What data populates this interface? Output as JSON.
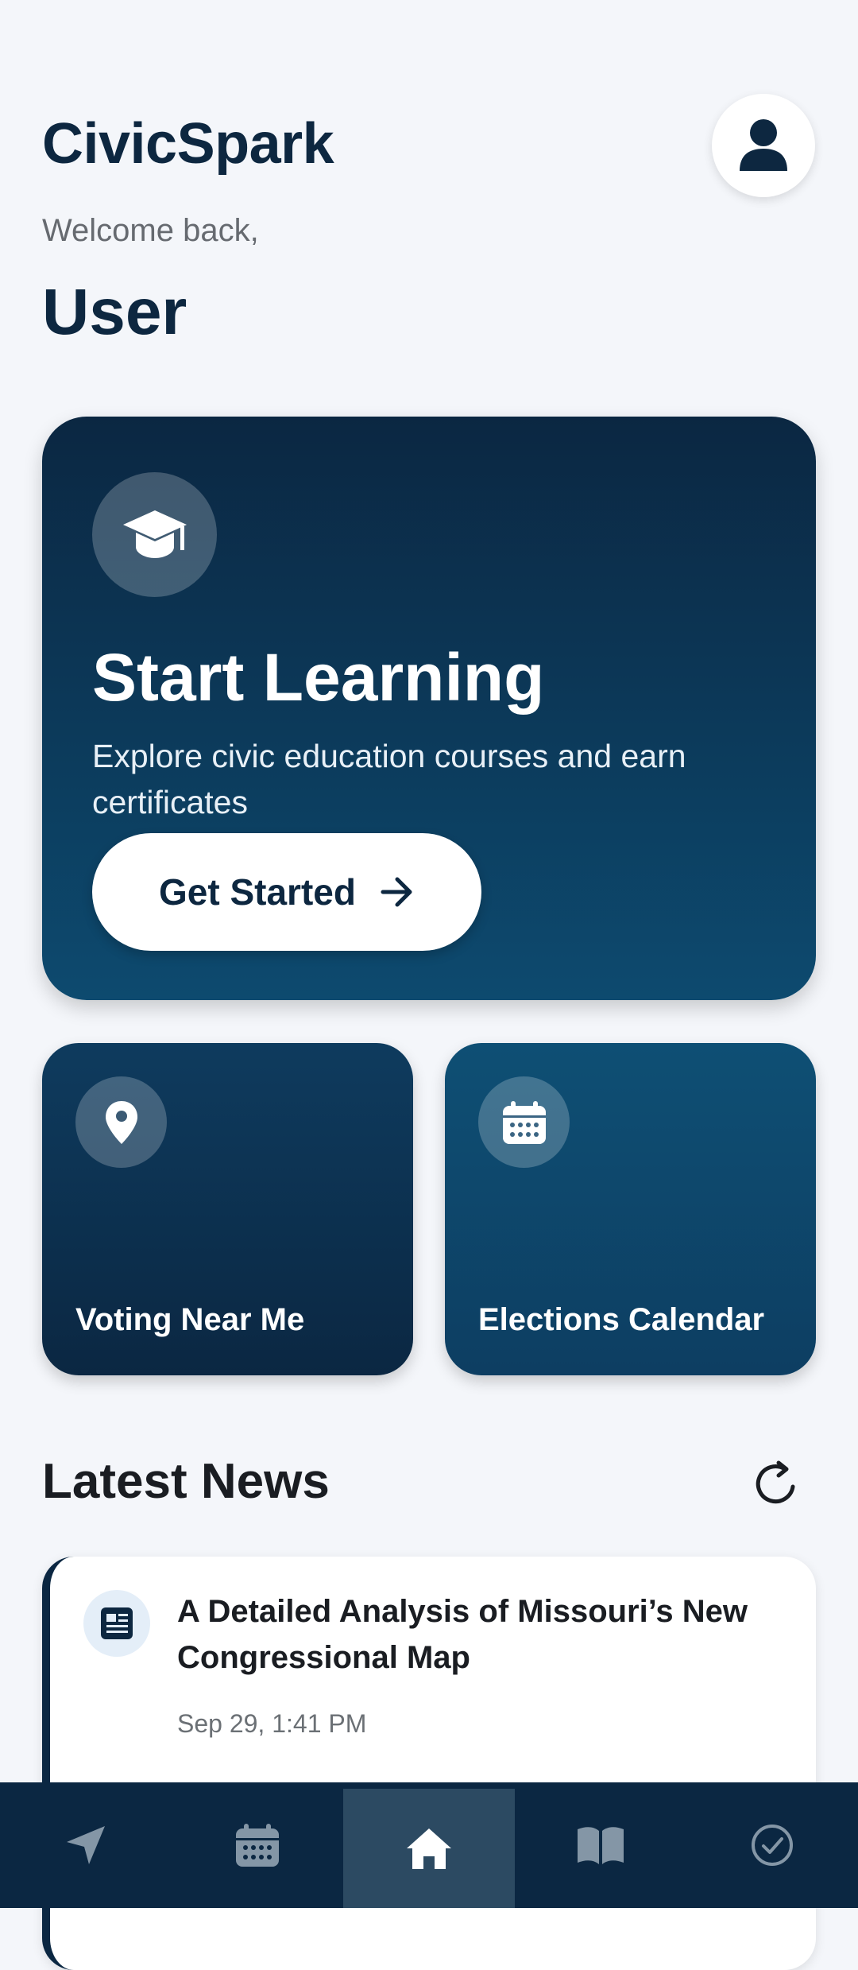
{
  "header": {
    "app_title": "CivicSpark",
    "welcome_text": "Welcome back,",
    "user_name": "User"
  },
  "hero": {
    "title": "Start Learning",
    "description": "Explore civic education courses and earn certificates",
    "button_label": "Get Started",
    "icon": "graduation-cap-icon"
  },
  "tiles": [
    {
      "label": "Voting Near Me",
      "icon": "map-pin-icon"
    },
    {
      "label": "Elections Calendar",
      "icon": "calendar-icon"
    }
  ],
  "news": {
    "section_title": "Latest News",
    "items": [
      {
        "title": "A Detailed Analysis of Missouri’s New Congressional Map",
        "date": "Sep 29, 1:41 PM",
        "icon": "newspaper-icon"
      }
    ]
  },
  "bottom_nav": {
    "items": [
      {
        "icon": "navigation-arrow-icon",
        "active": false
      },
      {
        "icon": "calendar-icon",
        "active": false
      },
      {
        "icon": "home-icon",
        "active": true
      },
      {
        "icon": "book-icon",
        "active": false
      },
      {
        "icon": "check-circle-icon",
        "active": false
      }
    ]
  },
  "colors": {
    "primary": "#0b2742",
    "accent": "#0d4a6f",
    "background": "#f4f6fa"
  }
}
